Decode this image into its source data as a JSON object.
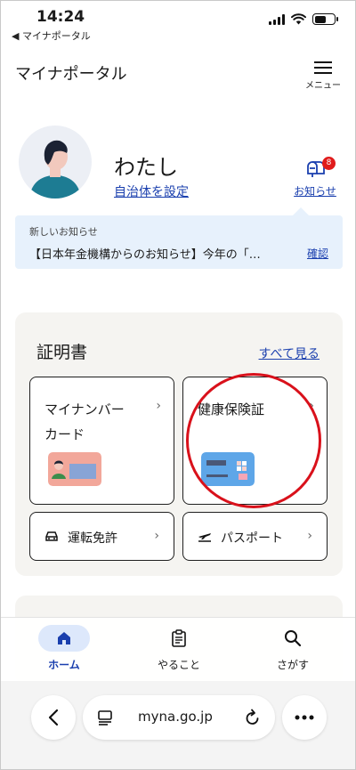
{
  "status_bar": {
    "time": "14:24",
    "back_app": "◀ マイナポータル"
  },
  "header": {
    "title": "マイナポータル",
    "menu_label": "メニュー"
  },
  "profile": {
    "name": "わたし",
    "set_municipality": "自治体を設定",
    "notice_label": "お知らせ",
    "notice_count": "8"
  },
  "banner": {
    "heading": "新しいお知らせ",
    "text": "【日本年金機構からのお知らせ】今年の「…",
    "confirm": "確認"
  },
  "certificates": {
    "title": "証明書",
    "see_all": "すべて見る",
    "my_number_card": "マイナンバーカード",
    "my_number_card_line1": "マイナンバー",
    "my_number_card_line2": "カード",
    "health_insurance": "健康保険証",
    "drivers_license": "運転免許",
    "passport": "パスポート"
  },
  "tabs": {
    "home": "ホーム",
    "todo": "やること",
    "search": "さがす"
  },
  "browser": {
    "url": "myna.go.jp"
  },
  "colors": {
    "accent": "#1a3fae",
    "annotation_circle": "#d9111b",
    "badge": "#e01b1b"
  }
}
